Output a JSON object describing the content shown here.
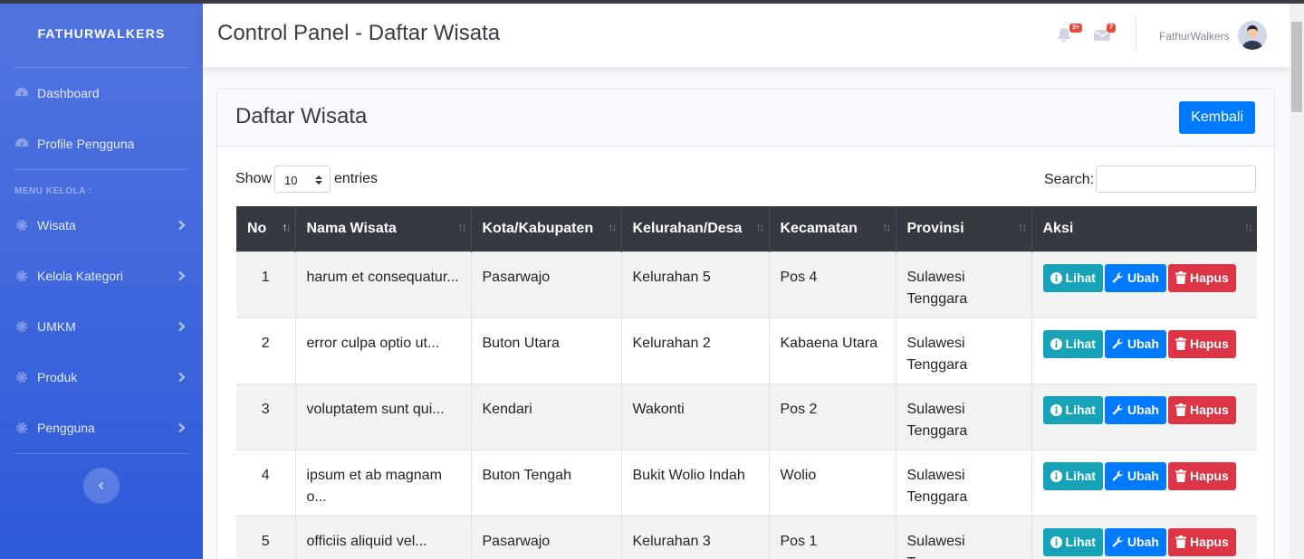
{
  "sidebar": {
    "brand": "FATHURWALKERS",
    "dashboard": "Dashboard",
    "profile": "Profile Pengguna",
    "heading": "MENU KELOLA :",
    "menu": [
      {
        "label": "Wisata"
      },
      {
        "label": "Kelola Kategori"
      },
      {
        "label": "UMKM"
      },
      {
        "label": "Produk"
      },
      {
        "label": "Pengguna"
      }
    ]
  },
  "topbar": {
    "title": "Control Panel - Daftar Wisata",
    "alerts_badge": "3+",
    "messages_badge": "7",
    "user_name": "FathurWalkers"
  },
  "card": {
    "title": "Daftar Wisata",
    "back_button": "Kembali"
  },
  "table_controls": {
    "show_label": "Show",
    "page_size": "10",
    "entries_label": "entries",
    "search_label": "Search:"
  },
  "table": {
    "headers": [
      "No",
      "Nama Wisata",
      "Kota/Kabupaten",
      "Kelurahan/Desa",
      "Kecamatan",
      "Provinsi",
      "Aksi"
    ],
    "rows": [
      {
        "no": "1",
        "nama": "harum et consequatur...",
        "kota": "Pasarwajo",
        "kelurahan": "Kelurahan 5",
        "kecamatan": "Pos 4",
        "provinsi": "Sulawesi Tenggara"
      },
      {
        "no": "2",
        "nama": "error culpa optio ut...",
        "kota": "Buton Utara",
        "kelurahan": "Kelurahan 2",
        "kecamatan": "Kabaena Utara",
        "provinsi": "Sulawesi Tenggara"
      },
      {
        "no": "3",
        "nama": "voluptatem sunt qui...",
        "kota": "Kendari",
        "kelurahan": "Wakonti",
        "kecamatan": "Pos 2",
        "provinsi": "Sulawesi Tenggara"
      },
      {
        "no": "4",
        "nama": "ipsum et ab magnam o...",
        "kota": "Buton Tengah",
        "kelurahan": "Bukit Wolio Indah",
        "kecamatan": "Wolio",
        "provinsi": "Sulawesi Tenggara"
      },
      {
        "no": "5",
        "nama": "officiis aliquid vel...",
        "kota": "Pasarwajo",
        "kelurahan": "Kelurahan 3",
        "kecamatan": "Pos 1",
        "provinsi": "Sulawesi Tenggara"
      }
    ],
    "actions": {
      "view": "Lihat",
      "edit": "Ubah",
      "delete": "Hapus"
    }
  },
  "colors": {
    "sidebar": "#4e73df",
    "primary": "#007bff",
    "info": "#17a2b8",
    "danger": "#dc3545",
    "table_header": "#343a40"
  }
}
